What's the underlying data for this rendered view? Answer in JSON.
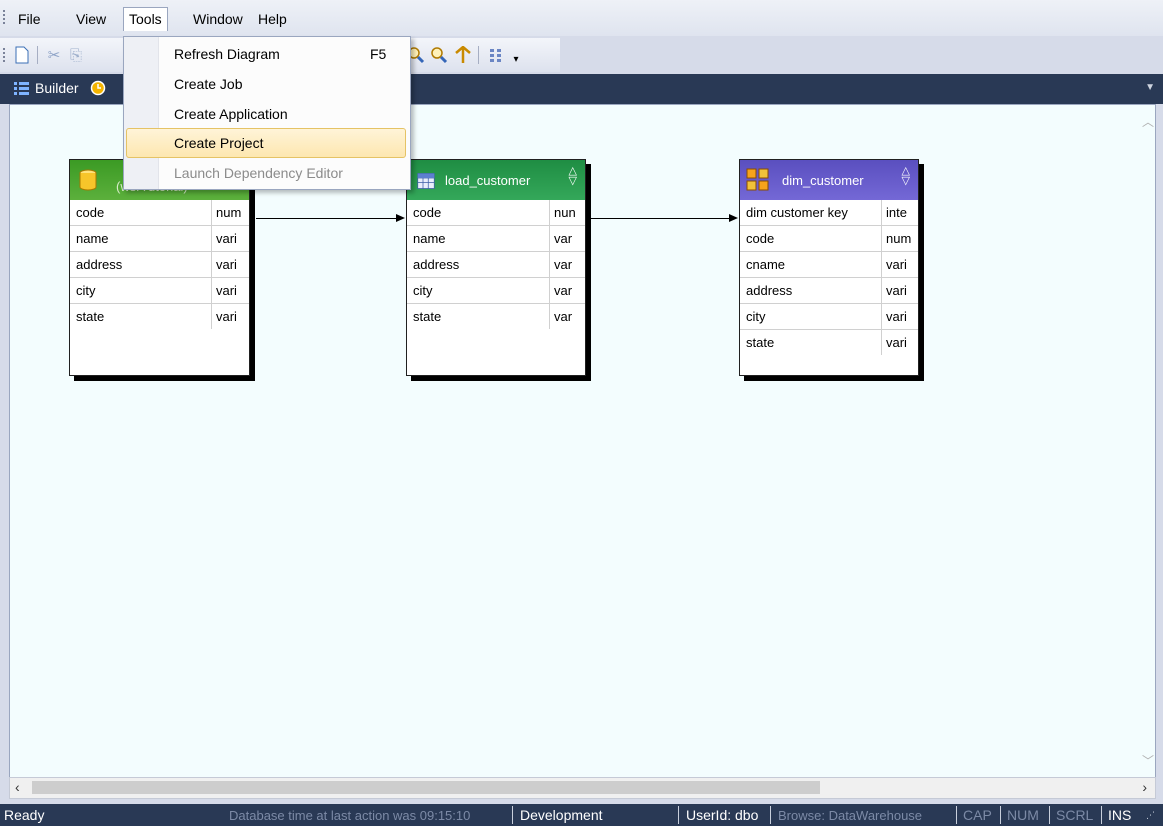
{
  "menubar": {
    "items": [
      "File",
      "View",
      "Tools",
      "Window",
      "Help"
    ],
    "open_item": "Tools"
  },
  "tools_menu": {
    "items": [
      {
        "label": "Refresh Diagram",
        "shortcut": "F5",
        "enabled": true,
        "highlighted": false
      },
      {
        "label": "Create Job",
        "shortcut": "",
        "enabled": true,
        "highlighted": false
      },
      {
        "label": "Create Application",
        "shortcut": "",
        "enabled": true,
        "highlighted": false
      },
      {
        "label": "Create Project",
        "shortcut": "",
        "enabled": true,
        "highlighted": true
      },
      {
        "label": "Launch Dependency Editor",
        "shortcut": "",
        "enabled": false,
        "highlighted": false
      }
    ]
  },
  "tabs": {
    "builder_label": "Builder"
  },
  "tables": [
    {
      "title": "(wsrTutorial)",
      "header_color": "#4aa232",
      "icon": "database-cylinder-icon",
      "rows": [
        {
          "name": "code",
          "type": "num"
        },
        {
          "name": "name",
          "type": "vari"
        },
        {
          "name": "address",
          "type": "vari"
        },
        {
          "name": "city",
          "type": "vari"
        },
        {
          "name": "state",
          "type": "vari"
        }
      ]
    },
    {
      "title": "load_customer",
      "header_color": "#2e9e4f",
      "icon": "grid-table-icon",
      "rows": [
        {
          "name": "code",
          "type": "nun"
        },
        {
          "name": "name",
          "type": "var"
        },
        {
          "name": "address",
          "type": "var"
        },
        {
          "name": "city",
          "type": "var"
        },
        {
          "name": "state",
          "type": "var"
        }
      ]
    },
    {
      "title": "dim_customer",
      "header_color": "#6c5fc4",
      "icon": "dimension-cubes-icon",
      "rows": [
        {
          "name": "dim customer key",
          "type": "inte"
        },
        {
          "name": "code",
          "type": "num"
        },
        {
          "name": "cname",
          "type": "vari"
        },
        {
          "name": "address",
          "type": "vari"
        },
        {
          "name": "city",
          "type": "vari"
        },
        {
          "name": "state",
          "type": "vari"
        }
      ]
    }
  ],
  "statusbar": {
    "ready": "Ready",
    "db_time": "Database time at last action was 09:15:10",
    "environment": "Development",
    "user": "UserId: dbo",
    "browse": "Browse: DataWarehouse",
    "cap": "CAP",
    "num": "NUM",
    "scrl": "SCRL",
    "ins": "INS"
  }
}
